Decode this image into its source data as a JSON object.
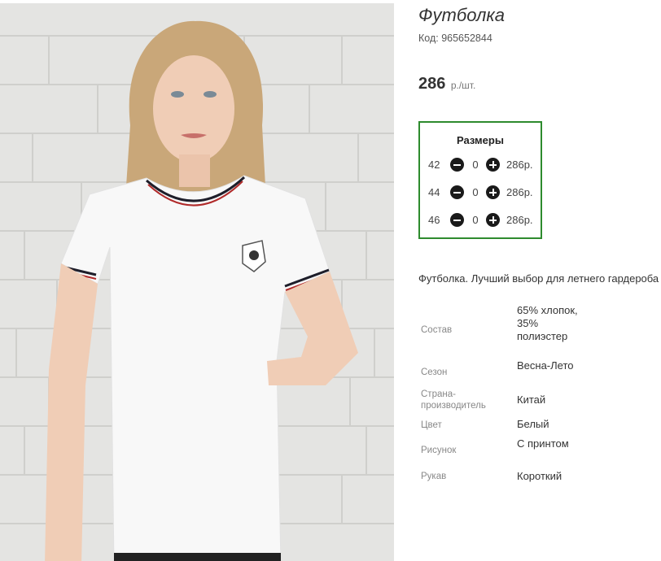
{
  "product": {
    "title": "Футболка",
    "code": "Код: 965652844",
    "price": "286",
    "price_unit": "р./шт."
  },
  "sizes": {
    "title": "Размеры",
    "rows": [
      {
        "size": "42",
        "qty": "0",
        "price": "286р."
      },
      {
        "size": "44",
        "qty": "0",
        "price": "286р."
      },
      {
        "size": "46",
        "qty": "0",
        "price": "286р."
      }
    ]
  },
  "description": "Футболка. Лучший выбор для летнего гардероба",
  "specs": [
    {
      "label": "Состав",
      "value": "65% хлопок, 35% полиэстер"
    },
    {
      "label": "Сезон",
      "value": "Весна-Лето"
    },
    {
      "label": "Страна-производитель",
      "value": "Китай"
    },
    {
      "label": "Цвет",
      "value": "Белый"
    },
    {
      "label": "Рисунок",
      "value": "С принтом"
    },
    {
      "label": "Рукав",
      "value": "Короткий"
    }
  ],
  "colors": {
    "accent_border": "#2e8b2e",
    "button": "#1a1a1a"
  },
  "icons": {
    "decrease": "minus-circle-icon",
    "increase": "plus-circle-icon"
  }
}
